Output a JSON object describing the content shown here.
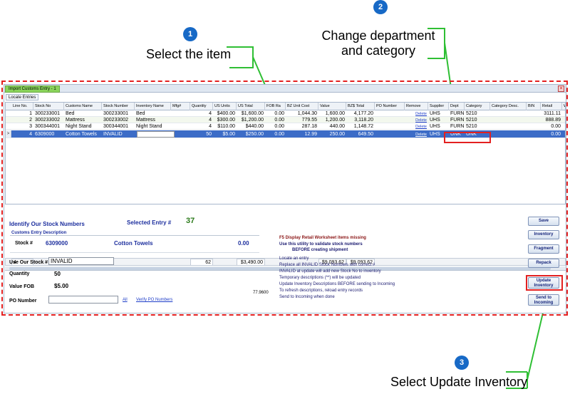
{
  "annotations": {
    "step1": {
      "num": "1",
      "text": "Select the item"
    },
    "step2": {
      "num": "2",
      "text": "Change department and category"
    },
    "step3": {
      "num": "3",
      "text": "Select Update Inventory"
    }
  },
  "window": {
    "tab": "Import Customs Entry - 1",
    "close": "×",
    "locate_button": "Locate Entries"
  },
  "grid": {
    "columns": [
      "Line No.",
      "Stock No",
      "Customs Name",
      "Stock Number",
      "Inventory Name",
      "Mfg#",
      "Quantity",
      "US Units",
      "US Total",
      "FOB Ra",
      "BZ Unit Cost",
      "Value",
      "BZ$ Total",
      "PO Number",
      "Remove",
      "Supplier",
      "Dept",
      "Category",
      "Category Desc.",
      "BIN",
      "Retail",
      "Wh"
    ],
    "rows": [
      [
        "1",
        "300233001",
        "Bed",
        "300233001",
        "Bed",
        "",
        "4",
        "$400.00",
        "$1,600.00",
        "0.00",
        "1,044.30",
        "1,600.00",
        "4,177.20",
        "",
        "Delete",
        "UHS",
        "FURN",
        "5210",
        "",
        "",
        "3111.11",
        ""
      ],
      [
        "2",
        "300233002",
        "Mattress",
        "300233002",
        "Mattress",
        "",
        "4",
        "$300.00",
        "$1,200.00",
        "0.00",
        "779.55",
        "1,200.00",
        "3,118.20",
        "",
        "Delete",
        "UHS",
        "FURN",
        "5210",
        "",
        "",
        "888.89",
        ""
      ],
      [
        "3",
        "300344001",
        "Night Stand",
        "300344001",
        "Night Stand",
        "",
        "4",
        "$110.00",
        "$440.00",
        "0.00",
        "287.18",
        "440.00",
        "1,148.72",
        "",
        "Delete",
        "UHS",
        "FURN",
        "5210",
        "",
        "",
        "0.00",
        ""
      ],
      [
        "4",
        "6309000",
        "Cotton Towels",
        "INVALID",
        "",
        "",
        "50",
        "$5.00",
        "$250.00",
        "0.00",
        "12.99",
        "250.00",
        "649.50",
        "",
        "Delete",
        "UHS",
        "UNK",
        "UNK",
        "",
        "",
        "0.00",
        ""
      ]
    ],
    "row_indicator": ">",
    "totals": {
      "count": "4",
      "quantity": "62",
      "us_total": "$3,490.00",
      "value": "$9,093.62",
      "bz_total": "$9,093.62"
    }
  },
  "form": {
    "identify_label": "Identify Our Stock Numbers",
    "selected_entry_label": "Selected Entry #",
    "selected_entry_value": "37",
    "customs_desc_label": "Customs Entry Description",
    "stock_label": "Stock #",
    "stock_value": "6309000",
    "stock_name": "Cotton Towels",
    "stock_amount": "0.00",
    "use_stock_label": "Use Our Stock #",
    "use_stock_value": "INVALID",
    "quantity_label": "Quantity",
    "quantity_value": "50",
    "value_fob_label": "Value FOB",
    "value_fob_value": "$5.00",
    "po_label": "PO Number",
    "po_value": "",
    "all_link": "All",
    "verify_link": "Verify PO Numbers",
    "small_number": "77.9600"
  },
  "instructions": {
    "f5": "F5 Display Retail Worksheet items missing",
    "use1": "Use this utility to validate stock numbers",
    "use2": "BEFORE creating shipment",
    "lines": [
      "Locate an entry",
      "Replace all INVALID Stock Numbers with correct #",
      "INVALID at update will add new Stock No to inventory",
      "Temporary descriptions (**)  will be updated",
      "Update Inventory Descriptions BEFORE sending to Incoming",
      "To refresh descriptions,  reload entry records",
      "Send to Incoming when done"
    ]
  },
  "buttons": {
    "save": "Save",
    "inventory": "Inventory",
    "fragment": "Fragment",
    "repack": "Repack",
    "update_inventory": "Update Inventory",
    "send_incoming": "Send to Incoming"
  }
}
